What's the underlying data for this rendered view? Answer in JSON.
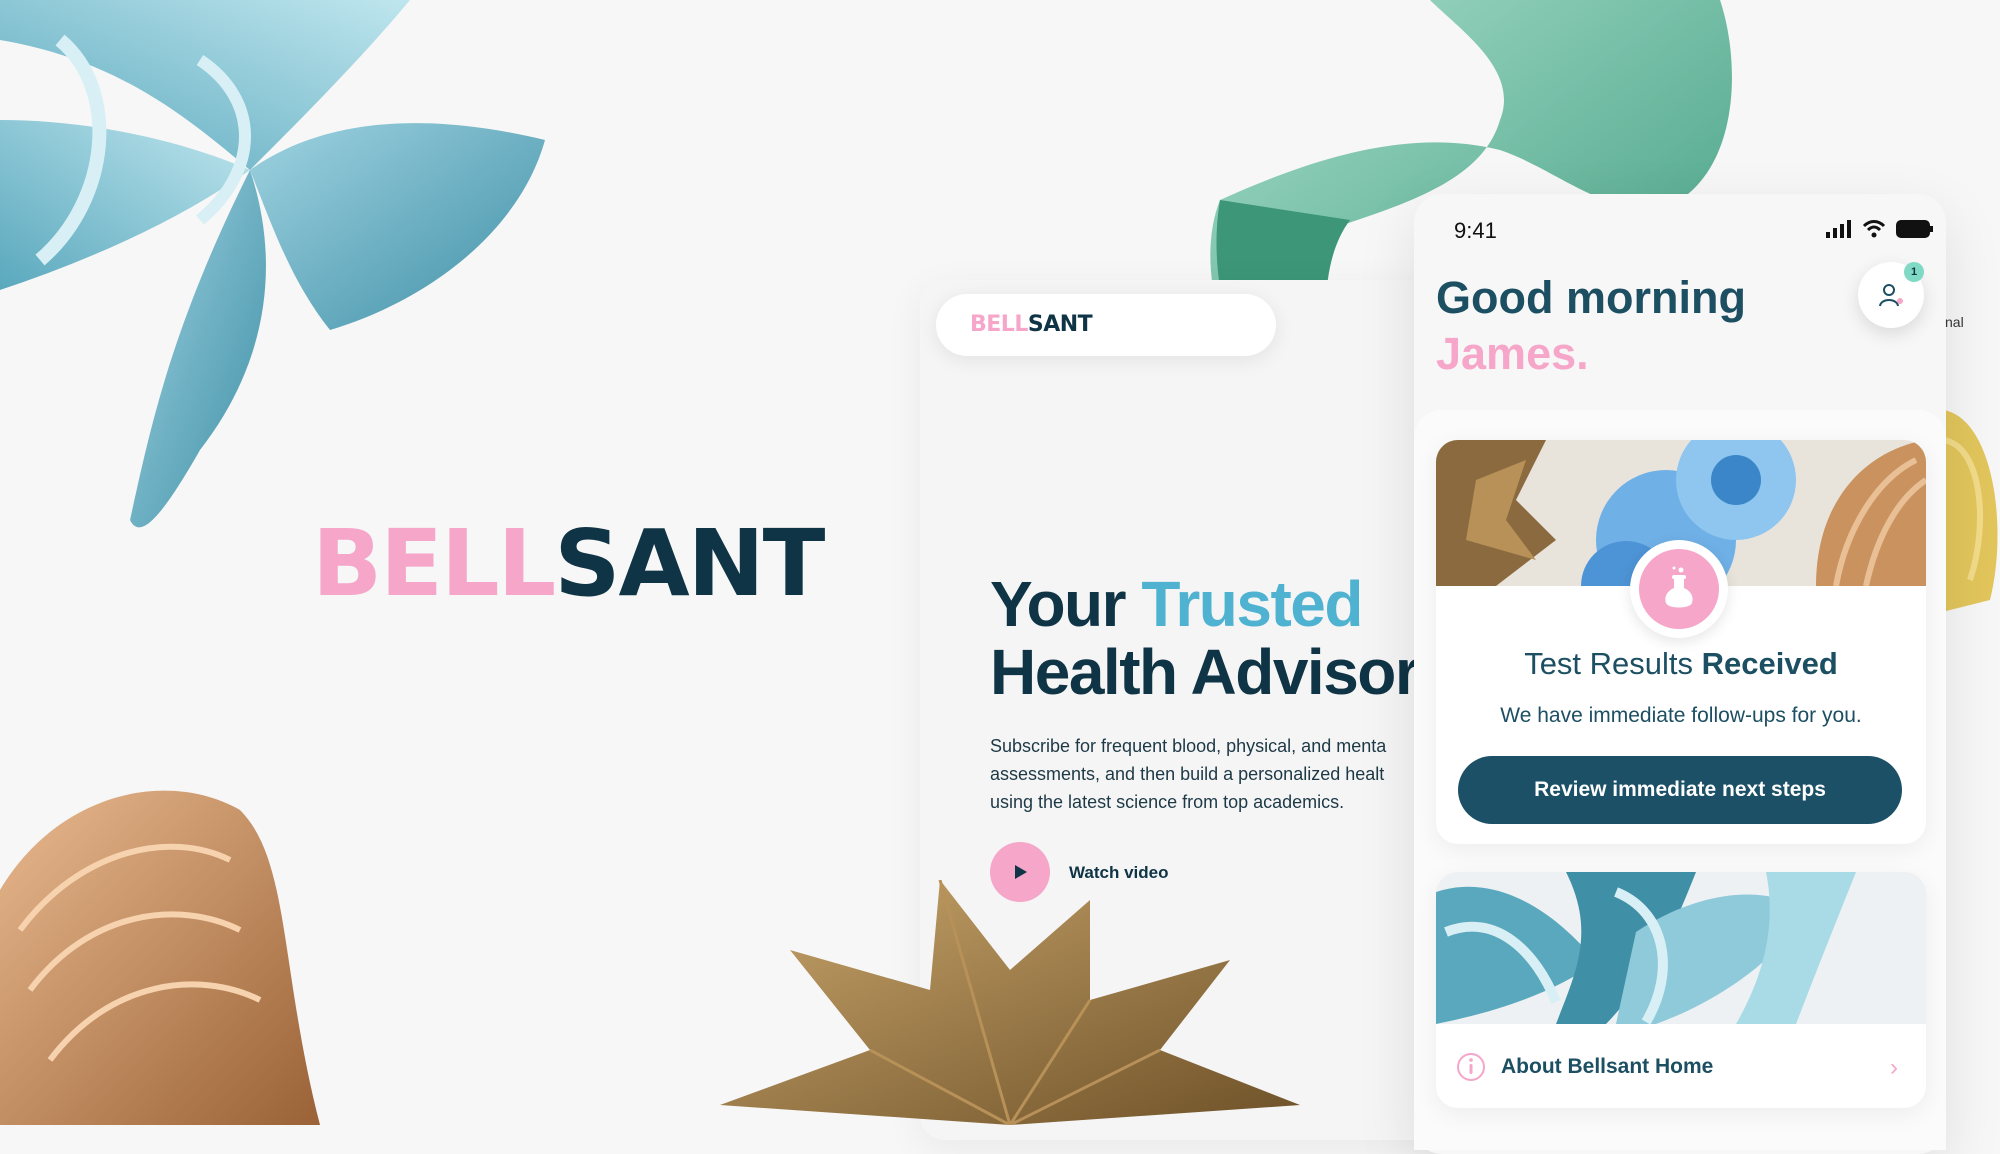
{
  "brand": {
    "logo_part1": "BELL",
    "logo_part2": "SANT",
    "colors": {
      "pink": "#f5a6c9",
      "navy": "#0f3445",
      "teal_accent": "#4fb2d1",
      "button": "#1b5067",
      "badge": "#7fd9c4"
    }
  },
  "website": {
    "nav_logo_part1": "BELL",
    "nav_logo_part2": "SANT",
    "hero_title_word1": "Your",
    "hero_title_word2": "Trusted",
    "hero_title_line2": "Health Advisor",
    "hero_text_line1": "Subscribe for frequent blood, physical, and menta",
    "hero_text_line2": "assessments, and then build a personalized healt",
    "hero_text_line3": "using the latest science from top academics.",
    "watch_label": "Watch video",
    "play_icon": "play-icon"
  },
  "phone": {
    "status_time": "9:41",
    "status_icons": [
      "signal-icon",
      "wifi-icon",
      "battery-icon"
    ],
    "greeting_line1": "Good morning",
    "greeting_name": "James.",
    "notification_count": "1",
    "side_peek_text": "nal",
    "result_card": {
      "icon": "flask-icon",
      "title_regular": "Test Results",
      "title_bold": "Received",
      "subtitle": "We have immediate follow-ups for you.",
      "button_label": "Review immediate next steps"
    },
    "about_card": {
      "icon": "info-icon",
      "label": "About Bellsant Home",
      "chevron": "›"
    }
  }
}
